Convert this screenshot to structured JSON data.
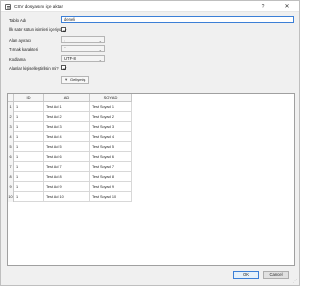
{
  "window": {
    "title": "CSV dosyasını içe aktar",
    "help_glyph": "?",
    "close_glyph": "✕"
  },
  "form": {
    "table_name_label": "Tablo Adı",
    "table_name_value": "deneli",
    "header_row_label": "İlk satır sütun isimleri içeriyor",
    "header_row_checked": true,
    "field_separator_label": "Alan ayıracı",
    "field_separator_value": ",",
    "quote_char_label": "Tırnak karakteri",
    "quote_char_value": "\"",
    "encoding_label": "Kodlama",
    "encoding_value": "UTF-8",
    "trim_fields_label": "Alanlar kişiselleştirilsin mi?",
    "trim_fields_checked": true,
    "refresh_label": "Gelişmiş"
  },
  "grid": {
    "columns": [
      "ID",
      "AD",
      "SOYAD"
    ],
    "rows": [
      {
        "num": "1",
        "id": "1",
        "ad": "Test Ad 1",
        "soyad": "Test Soyad 1"
      },
      {
        "num": "2",
        "id": "1",
        "ad": "Test Ad 2",
        "soyad": "Test Soyad 2"
      },
      {
        "num": "3",
        "id": "1",
        "ad": "Test Ad 3",
        "soyad": "Test Soyad 3"
      },
      {
        "num": "4",
        "id": "1",
        "ad": "Test Ad 4",
        "soyad": "Test Soyad 4"
      },
      {
        "num": "5",
        "id": "1",
        "ad": "Test Ad 5",
        "soyad": "Test Soyad 5"
      },
      {
        "num": "6",
        "id": "1",
        "ad": "Test Ad 6",
        "soyad": "Test Soyad 6"
      },
      {
        "num": "7",
        "id": "1",
        "ad": "Test Ad 7",
        "soyad": "Test Soyad 7"
      },
      {
        "num": "8",
        "id": "1",
        "ad": "Test Ad 8",
        "soyad": "Test Soyad 8"
      },
      {
        "num": "9",
        "id": "1",
        "ad": "Test Ad 9",
        "soyad": "Test Soyad 9"
      },
      {
        "num": "10",
        "id": "1",
        "ad": "Test Ad 10",
        "soyad": "Test Soyad 10"
      }
    ]
  },
  "footer": {
    "ok_label": "OK",
    "cancel_label": "Cancel"
  }
}
